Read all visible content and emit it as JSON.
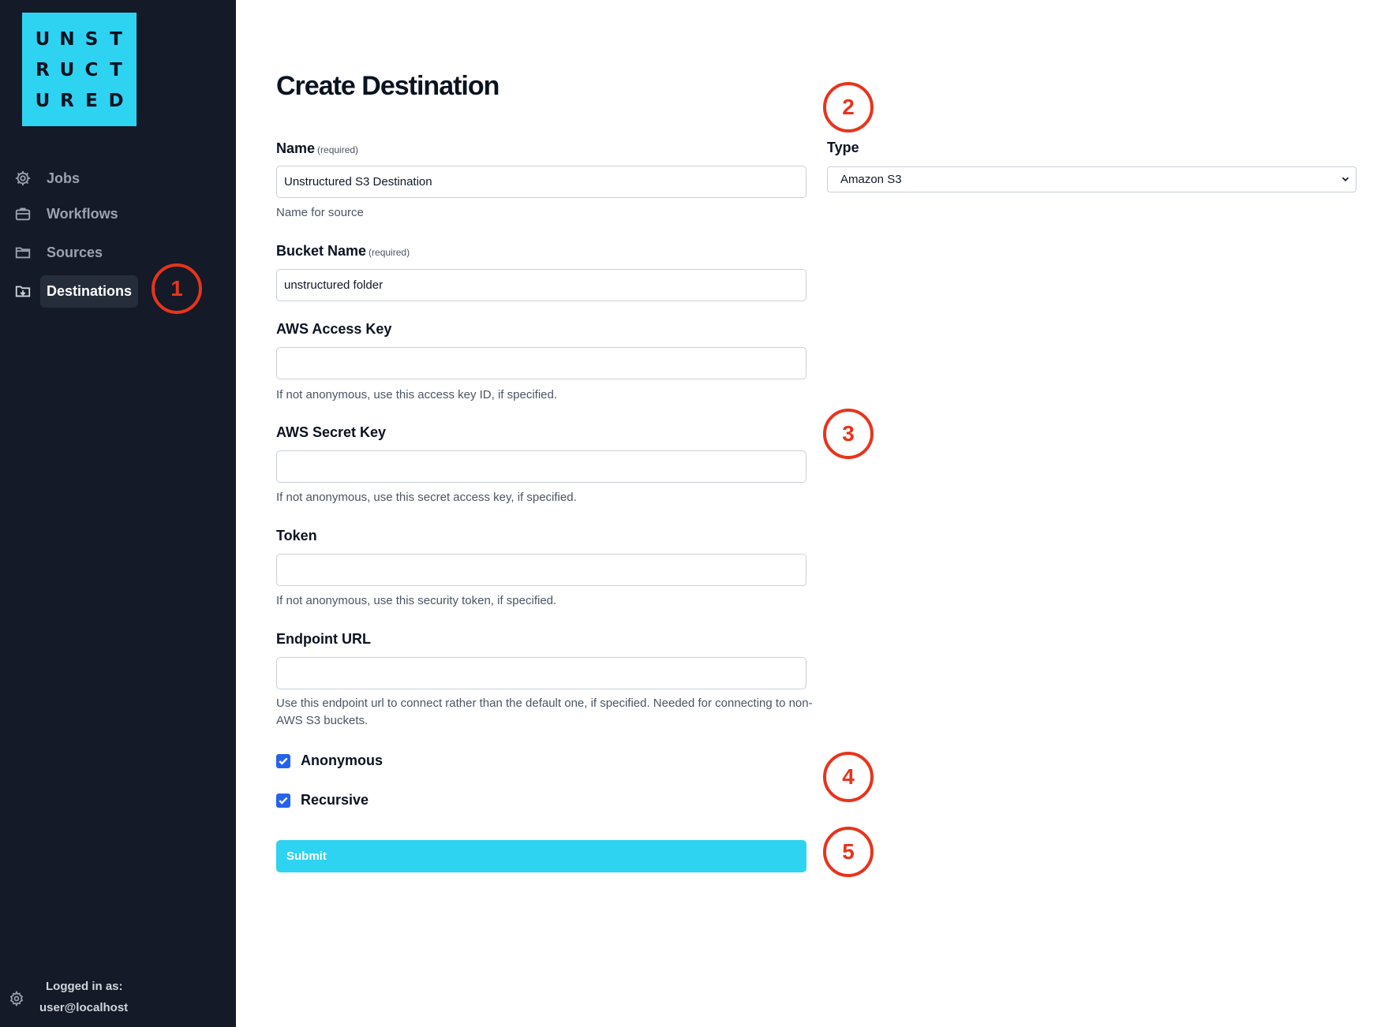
{
  "logo": {
    "rows": [
      [
        "U",
        "N",
        "S",
        "T"
      ],
      [
        "R",
        "U",
        "C",
        "T"
      ],
      [
        "U",
        "R",
        "E",
        "D"
      ]
    ]
  },
  "sidebar": {
    "items": [
      {
        "label": "Jobs",
        "icon": "gear-icon"
      },
      {
        "label": "Workflows",
        "icon": "briefcase-icon"
      },
      {
        "label": "Sources",
        "icon": "folder-icon"
      },
      {
        "label": "Destinations",
        "icon": "folder-download-icon",
        "active": true
      }
    ],
    "footer": {
      "logged_in_label": "Logged in as:",
      "user": "user@localhost",
      "icon": "settings-icon"
    }
  },
  "form": {
    "title": "Create Destination",
    "required_tag": "(required)",
    "name": {
      "label": "Name",
      "value": "Unstructured S3 Destination",
      "help": "Name for source"
    },
    "type": {
      "label": "Type",
      "value": "Amazon S3"
    },
    "bucket": {
      "label": "Bucket Name",
      "value": "unstructured folder"
    },
    "access_key": {
      "label": "AWS Access Key",
      "value": "",
      "help": "If not anonymous, use this access key ID, if specified."
    },
    "secret_key": {
      "label": "AWS Secret Key",
      "value": "",
      "help": "If not anonymous, use this secret access key, if specified."
    },
    "token": {
      "label": "Token",
      "value": "",
      "help": "If not anonymous, use this security token, if specified."
    },
    "endpoint": {
      "label": "Endpoint URL",
      "value": "",
      "help": "Use this endpoint url to connect rather than the default one, if specified. Needed for connecting to non-AWS S3 buckets."
    },
    "anonymous": {
      "label": "Anonymous",
      "checked": true
    },
    "recursive": {
      "label": "Recursive",
      "checked": true
    },
    "submit_label": "Submit"
  },
  "markers": [
    "1",
    "2",
    "3",
    "4",
    "5"
  ],
  "colors": {
    "sidebar": "#141a27",
    "accent": "#2ed3f2",
    "checkbox": "#2563eb",
    "marker": "#e8341c"
  }
}
